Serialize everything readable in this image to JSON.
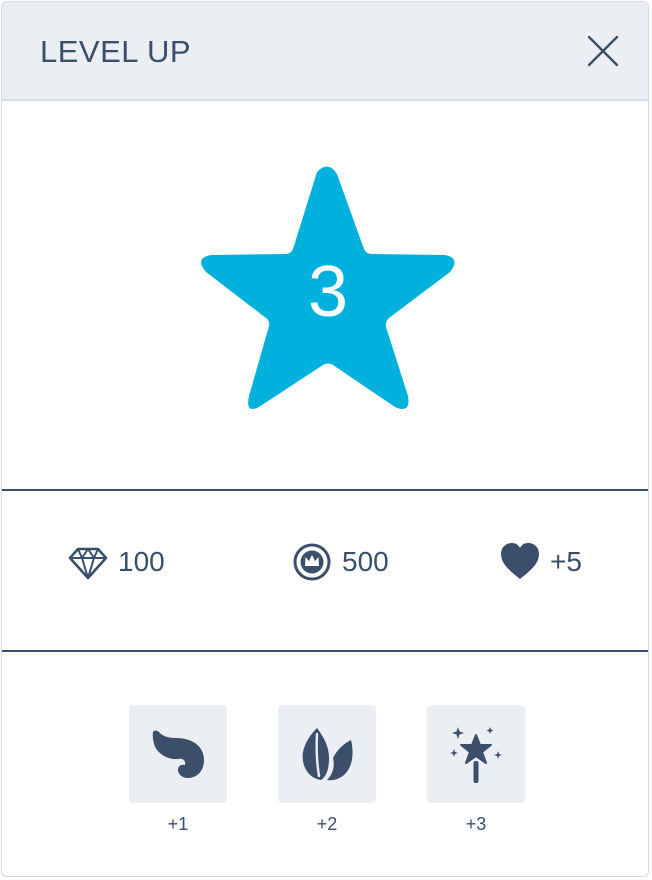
{
  "dialog": {
    "title": "LEVEL UP",
    "close_icon": "close-icon"
  },
  "level": {
    "value": "3",
    "star_color": "#00b1de"
  },
  "rewards": [
    {
      "icon": "diamond-icon",
      "value": "100"
    },
    {
      "icon": "crown-coin-icon",
      "value": "500"
    },
    {
      "icon": "heart-icon",
      "value": "+5"
    }
  ],
  "items": [
    {
      "icon": "wing-icon",
      "count": "+1"
    },
    {
      "icon": "leaf-icon",
      "count": "+2"
    },
    {
      "icon": "magic-wand-icon",
      "count": "+3"
    }
  ],
  "colors": {
    "text": "#3b4f6b",
    "header_bg": "#ebeef3",
    "accent": "#00b1de"
  }
}
